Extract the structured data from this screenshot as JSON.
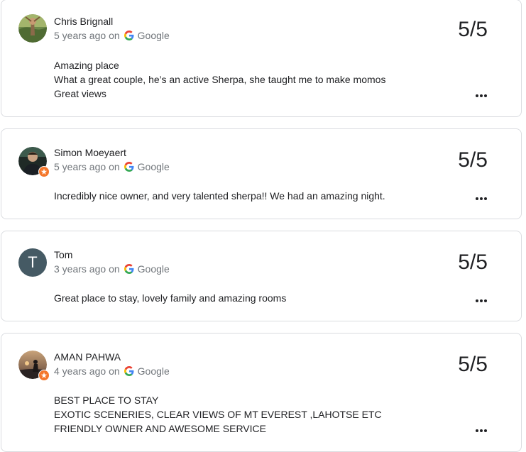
{
  "reviews": [
    {
      "reviewer": "Chris Brignall",
      "time": "5 years ago",
      "on": "on",
      "source": "Google",
      "rating": "5/5",
      "lines": [
        "Amazing place",
        "What a great couple, he’s an active Sherpa, she taught me to make momos",
        "Great views"
      ],
      "avatar_icon": "profile-photo",
      "local_guide": false
    },
    {
      "reviewer": "Simon Moeyaert",
      "time": "5 years ago",
      "on": "on",
      "source": "Google",
      "rating": "5/5",
      "lines": [
        "Incredibly nice owner, and very talented sherpa!! We had an amazing night."
      ],
      "avatar_icon": "profile-photo",
      "local_guide": true
    },
    {
      "reviewer": "Tom",
      "time": "3 years ago",
      "on": "on",
      "source": "Google",
      "rating": "5/5",
      "lines": [
        "Great place to stay, lovely family and amazing rooms"
      ],
      "avatar_letter": "T",
      "avatar_color": "#455a64",
      "local_guide": false
    },
    {
      "reviewer": "AMAN PAHWA",
      "time": "4 years ago",
      "on": "on",
      "source": "Google",
      "rating": "5/5",
      "lines": [
        "BEST PLACE TO STAY",
        "EXOTIC SCENERIES, CLEAR VIEWS OF MT EVEREST ,LAHOTSE ETC",
        "FRIENDLY OWNER AND AWESOME SERVICE"
      ],
      "avatar_icon": "profile-photo",
      "local_guide": true
    }
  ],
  "colors": {
    "border": "#dadce0",
    "meta_text": "#70757a",
    "primary_text": "#202124",
    "local_guide_badge": "#f4772b",
    "letter_avatar": "#455a64"
  },
  "icons": {
    "source_logo": "google-g-icon",
    "more_menu": "more-options-icon",
    "badge": "local-guide-badge-icon"
  }
}
